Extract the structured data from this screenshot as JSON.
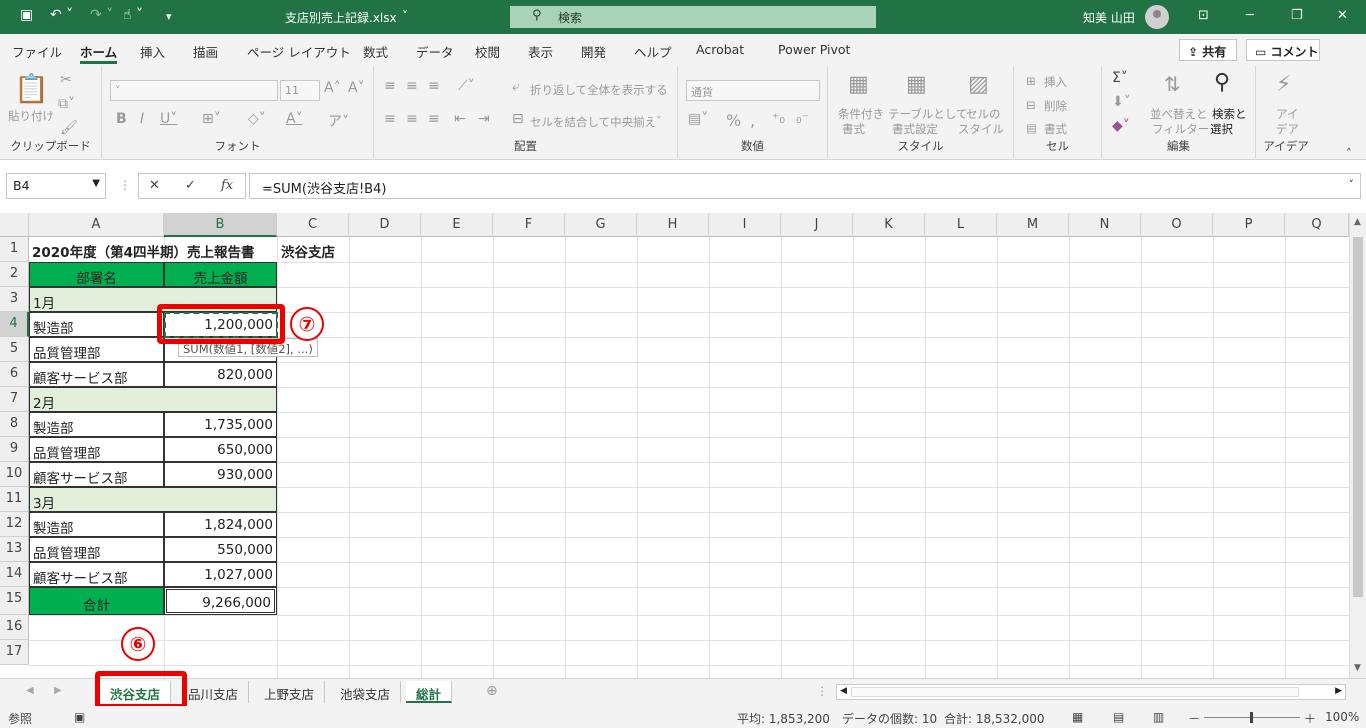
{
  "titlebar": {
    "filename": "支店別売上記録.xlsx",
    "search": "検索",
    "user": "知美 山田"
  },
  "tabs": [
    "ファイル",
    "ホーム",
    "挿入",
    "描画",
    "ページ レイアウト",
    "数式",
    "データ",
    "校閲",
    "表示",
    "開発",
    "ヘルプ",
    "Acrobat",
    "Power Pivot"
  ],
  "share": "共有",
  "comment": "コメント",
  "ribbon": {
    "clipboard": {
      "paste": "貼り付け",
      "label": "クリップボード"
    },
    "font": {
      "size": "11",
      "label": "フォント"
    },
    "alignment": {
      "wrap": "折り返して全体を表示する",
      "merge": "セルを結合して中央揃え",
      "label": "配置"
    },
    "number": {
      "format": "通貨",
      "label": "数値"
    },
    "styles": {
      "cond1": "条件付き",
      "cond2": "書式",
      "table1": "テーブルとして",
      "table2": "書式設定",
      "cell1": "セルの",
      "cell2": "スタイル",
      "label": "スタイル"
    },
    "cells": {
      "insert": "挿入",
      "delete": "削除",
      "format": "書式",
      "label": "セル"
    },
    "editing": {
      "sort1": "並べ替えと",
      "sort2": "フィルター",
      "find1": "検索と",
      "find2": "選択",
      "label": "編集"
    },
    "ideas": {
      "l1": "アイ",
      "l2": "デア",
      "label": "アイデア"
    }
  },
  "formula": {
    "namebox": "B4",
    "fx": "fx",
    "content": "=SUM(渋谷支店!B4)"
  },
  "columns": [
    "A",
    "B",
    "C",
    "D",
    "E",
    "F",
    "G",
    "H",
    "I",
    "J",
    "K",
    "L",
    "M",
    "N",
    "O",
    "P",
    "Q"
  ],
  "rows": [
    "1",
    "2",
    "3",
    "4",
    "5",
    "6",
    "7",
    "8",
    "9",
    "10",
    "11",
    "12",
    "13",
    "14",
    "15",
    "16",
    "17"
  ],
  "cells": {
    "title": "2020年度（第4四半期）売上報告書",
    "branch": "渋谷支店",
    "hdr_dept": "部署名",
    "hdr_sales": "売上金額",
    "m1": "1月",
    "r4a": "製造部",
    "r4b": "1,200,000",
    "r5a": "品質管理部",
    "r6a": "顧客サービス部",
    "r6b": "820,000",
    "m2": "2月",
    "r8a": "製造部",
    "r8b": "1,735,000",
    "r9a": "品質管理部",
    "r9b": "650,000",
    "r10a": "顧客サービス部",
    "r10b": "930,000",
    "m3": "3月",
    "r12a": "製造部",
    "r12b": "1,824,000",
    "r13a": "品質管理部",
    "r13b": "550,000",
    "r14a": "顧客サービス部",
    "r14b": "1,027,000",
    "total": "合計",
    "totalb": "9,266,000"
  },
  "tooltip": "SUM(数値1, [数値2], ...)",
  "sheets": [
    "渋谷支店",
    "品川支店",
    "上野支店",
    "池袋支店",
    "総計"
  ],
  "status": {
    "mode": "参照",
    "avg": "平均: 1,853,200",
    "count": "データの個数: 10",
    "sum": "合計: 18,532,000",
    "zoom": "100%"
  },
  "annotations": {
    "seven": "⑦",
    "six": "⑥"
  },
  "colors": {
    "brand": "#217346",
    "header_green": "#00b050",
    "month_fill": "#e2efda",
    "annotation": "#e00000"
  }
}
